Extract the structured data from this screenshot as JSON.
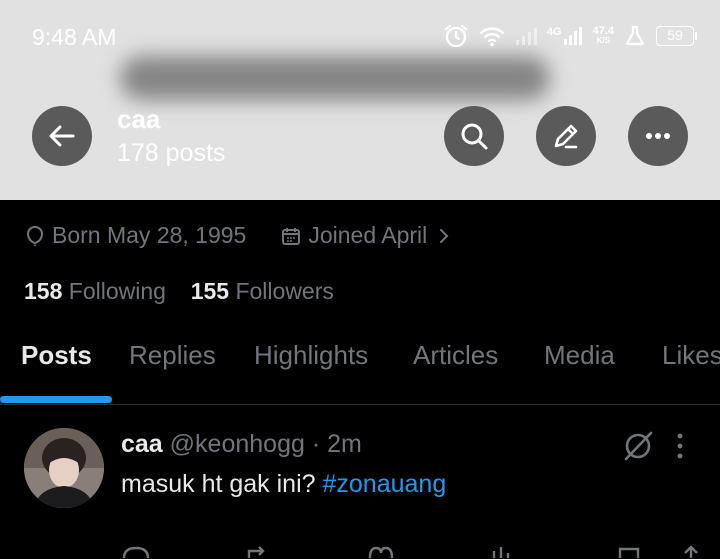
{
  "status_bar": {
    "time": "9:48 AM",
    "network": "4G",
    "speed_value": "47.4",
    "speed_unit": "K/S",
    "battery": "59"
  },
  "header": {
    "name": "caa",
    "post_count": "178 posts"
  },
  "profile": {
    "born": "Born May 28, 1995",
    "joined": "Joined April",
    "following_count": "158",
    "following_label": "Following",
    "followers_count": "155",
    "followers_label": "Followers"
  },
  "tabs": [
    {
      "label": "Posts",
      "active": true
    },
    {
      "label": "Replies"
    },
    {
      "label": "Highlights"
    },
    {
      "label": "Articles"
    },
    {
      "label": "Media"
    },
    {
      "label": "Likes"
    }
  ],
  "tweet": {
    "display_name": "caa",
    "handle": "@keonhogg",
    "separator": "·",
    "time": "2m",
    "text": "masuk ht gak ini? ",
    "hashtag": "#zonauang"
  },
  "colors": {
    "accent": "#1d9bf0",
    "header_bg": "#e1e1e1",
    "button_bg": "#5a5a5a",
    "muted_text": "#71767b",
    "primary_text": "#e7e9ea"
  }
}
